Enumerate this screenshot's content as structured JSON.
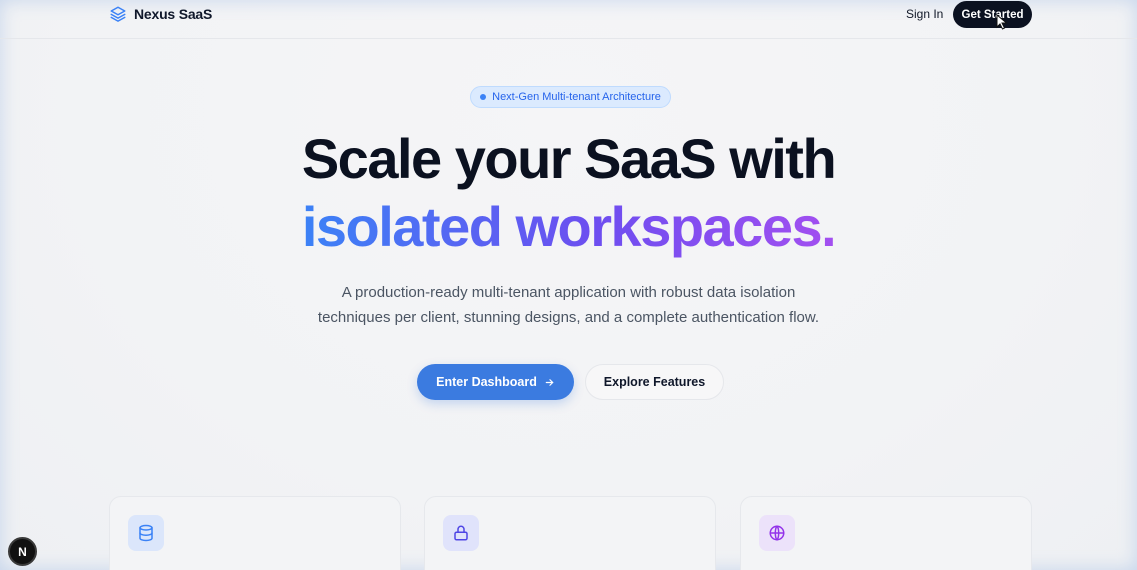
{
  "header": {
    "brand_name": "Nexus SaaS",
    "sign_in_label": "Sign In",
    "get_started_label": "Get Started"
  },
  "hero": {
    "badge_text": "Next-Gen Multi-tenant Architecture",
    "headline_line1": "Scale your SaaS with",
    "headline_line2": "isolated workspaces.",
    "subtitle_line1": "A production-ready multi-tenant application with robust data isolation",
    "subtitle_line2": "techniques per client, stunning designs, and a complete authentication flow.",
    "primary_cta_label": "Enter Dashboard",
    "secondary_cta_label": "Explore Features"
  },
  "features": [
    {
      "icon": "database-icon",
      "accent": "#3b82f6",
      "bg": "#dbe6fb"
    },
    {
      "icon": "lock-icon",
      "accent": "#4f46e5",
      "bg": "#e0e3fb"
    },
    {
      "icon": "globe-icon",
      "accent": "#9333ea",
      "bg": "#ece2fa"
    }
  ],
  "dev_badge_letter": "N",
  "colors": {
    "brand_accent": "#3b82f6",
    "primary_button": "#3b7be0",
    "dark_button": "#0b1120",
    "gradient_start": "#3b82f6",
    "gradient_end": "#a34ff0"
  }
}
